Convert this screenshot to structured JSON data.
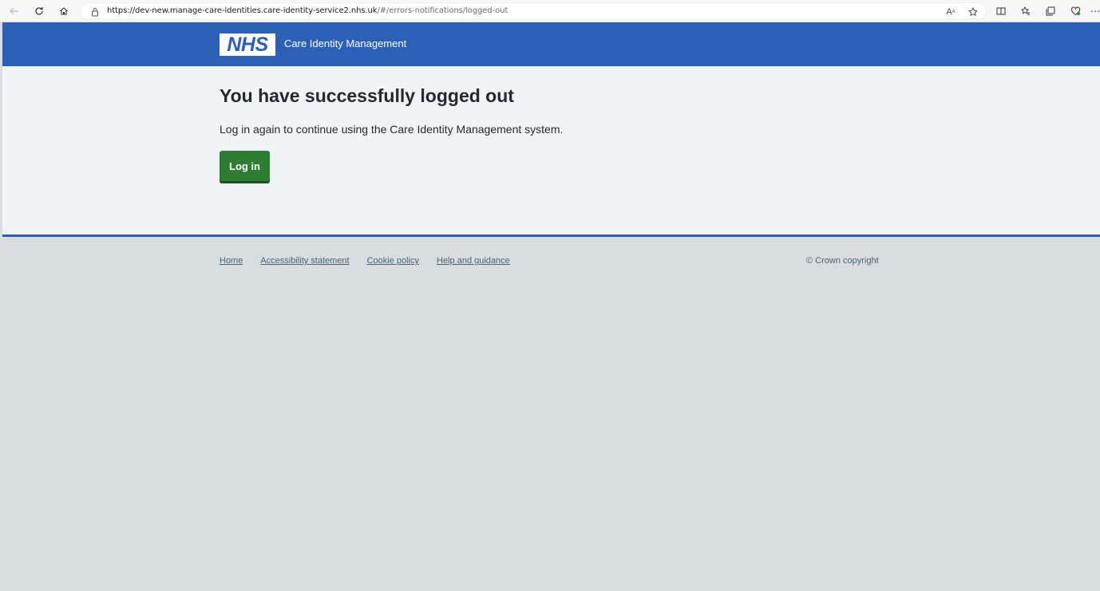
{
  "browser": {
    "url_host": "https://dev-new.manage-care-identities.care-identity-service2.nhs.uk",
    "url_path": "/#/errors-notifications/logged-out",
    "icons": [
      "back-icon",
      "refresh-icon",
      "home-icon",
      "lock-icon",
      "read-aloud-icon",
      "favorite-star-icon",
      "split-screen-icon",
      "favorites-icon",
      "collections-icon",
      "extensions-icon",
      "more-icon"
    ]
  },
  "header": {
    "logo_text": "NHS",
    "service_name": "Care Identity Management",
    "background": "#2c5fb6"
  },
  "main": {
    "title": "You have successfully logged out",
    "body": "Log in again to continue using the Care Identity Management system.",
    "login_button": "Log in",
    "button_color": "#2e7d32"
  },
  "footer": {
    "links": [
      "Home",
      "Accessibility statement",
      "Cookie policy",
      "Help and guidance"
    ],
    "copyright": "© Crown copyright"
  }
}
